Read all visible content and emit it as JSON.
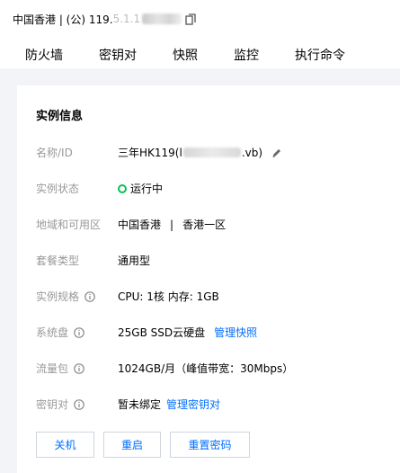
{
  "header": {
    "ip_prefix": "中国香港 | (公) 119.",
    "ip_visible": "5.1.1"
  },
  "tabs": [
    {
      "label": "防火墙"
    },
    {
      "label": "密钥对"
    },
    {
      "label": "快照"
    },
    {
      "label": "监控"
    },
    {
      "label": "执行命令"
    }
  ],
  "card": {
    "title": "实例信息",
    "rows": {
      "name": {
        "label": "名称/ID",
        "value_prefix": "三年HK119(l",
        "value_suffix": ".vb)"
      },
      "status": {
        "label": "实例状态",
        "value": "运行中",
        "color": "#0abf5b"
      },
      "region": {
        "label": "地域和可用区",
        "region": "中国香港",
        "separator": "|",
        "zone": "香港一区"
      },
      "plan": {
        "label": "套餐类型",
        "value": "通用型"
      },
      "spec": {
        "label": "实例规格",
        "value": "CPU: 1核 内存: 1GB"
      },
      "disk": {
        "label": "系统盘",
        "value": "25GB SSD云硬盘",
        "link": "管理快照"
      },
      "traffic": {
        "label": "流量包",
        "value": "1024GB/月（峰值带宽：30Mbps）"
      },
      "keypair": {
        "label": "密钥对",
        "value": "暂未绑定",
        "link": "管理密钥对"
      }
    },
    "buttons": {
      "shutdown": "关机",
      "restart": "重启",
      "reset_password": "重置密码"
    }
  },
  "colors": {
    "link": "#006eff",
    "label": "#999999",
    "running": "#0abf5b"
  }
}
